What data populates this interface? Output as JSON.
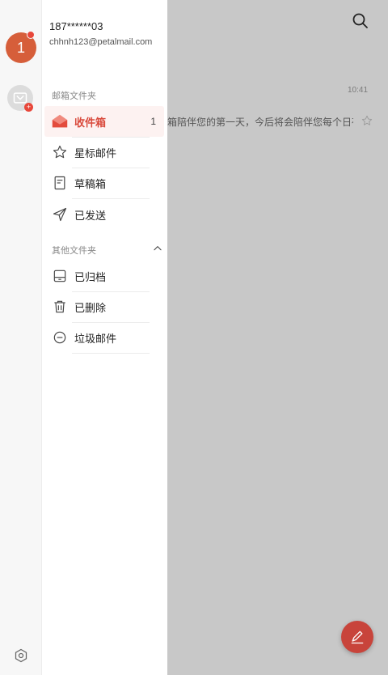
{
  "account": {
    "avatar_letter": "1",
    "phone": "187******03",
    "email": "chhnh123@petalmail.com"
  },
  "sections": {
    "mail_folders": "邮箱文件夹",
    "other_folders": "其他文件夹"
  },
  "folders": [
    {
      "label": "收件箱",
      "count": "1",
      "icon": "inbox-icon"
    },
    {
      "label": "星标邮件",
      "icon": "star-icon"
    },
    {
      "label": "草稿箱",
      "icon": "draft-icon"
    },
    {
      "label": "已发送",
      "icon": "sent-icon"
    }
  ],
  "other_folders": [
    {
      "label": "已归档",
      "icon": "archive-icon"
    },
    {
      "label": "已删除",
      "icon": "trash-icon"
    },
    {
      "label": "垃圾邮件",
      "icon": "spam-icon"
    }
  ],
  "background": {
    "time": "10:41",
    "preview": "箱陪伴您的第一天，今后将会陪伴您每个日夜…"
  },
  "colors": {
    "accent": "#d94a3c",
    "avatar": "#d65e3a",
    "fab": "#c8443b"
  },
  "add_badge": "+"
}
